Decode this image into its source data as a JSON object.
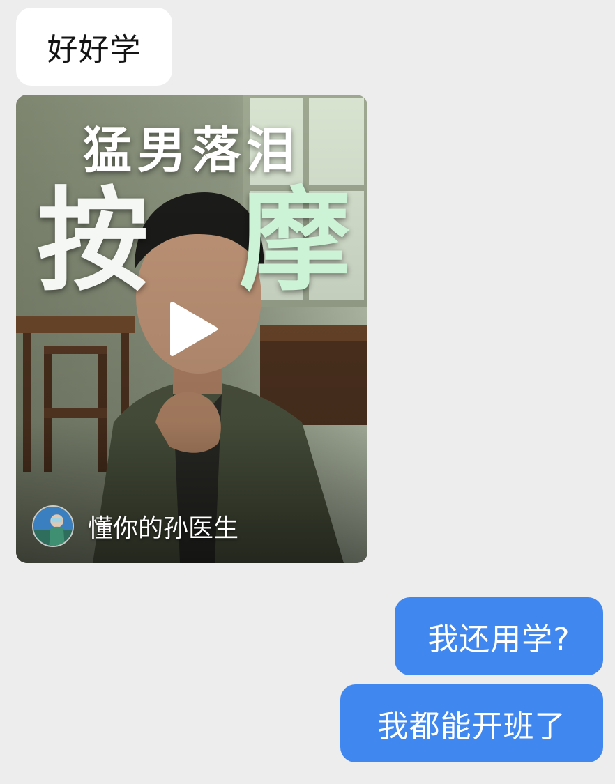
{
  "messages": [
    {
      "direction": "incoming",
      "text": "好好学"
    },
    {
      "direction": "incoming",
      "video": {
        "title_top": "猛男落泪",
        "title_big_1": "按",
        "title_big_2": "摩",
        "author": "懂你的孙医生"
      }
    },
    {
      "direction": "outgoing",
      "text": "我还用学?"
    },
    {
      "direction": "outgoing",
      "text": "我都能开班了"
    }
  ],
  "colors": {
    "background": "#ededed",
    "incoming_bubble": "#ffffff",
    "outgoing_bubble": "#4187f0"
  },
  "icons": [
    "play-icon",
    "avatar"
  ]
}
